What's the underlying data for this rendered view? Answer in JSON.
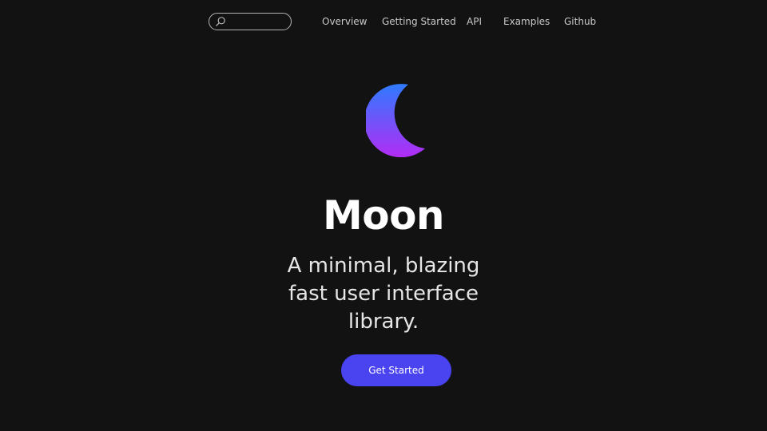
{
  "navbar": {
    "search": {
      "placeholder": "",
      "value": ""
    },
    "links": [
      {
        "label": "Overview"
      },
      {
        "label": "Getting Started"
      },
      {
        "label": "API"
      },
      {
        "label": "Examples"
      },
      {
        "label": "Github"
      }
    ]
  },
  "hero": {
    "logo_icon": "crescent-moon-icon",
    "title": "Moon",
    "tagline_lines": [
      "A minimal, blazing",
      "fast user interface",
      "library."
    ],
    "cta_label": "Get Started"
  },
  "colors": {
    "background": "#121212",
    "accent": "#4a43f0",
    "logo_gradient_top": "#2f7bff",
    "logo_gradient_bottom": "#b22cf5"
  }
}
